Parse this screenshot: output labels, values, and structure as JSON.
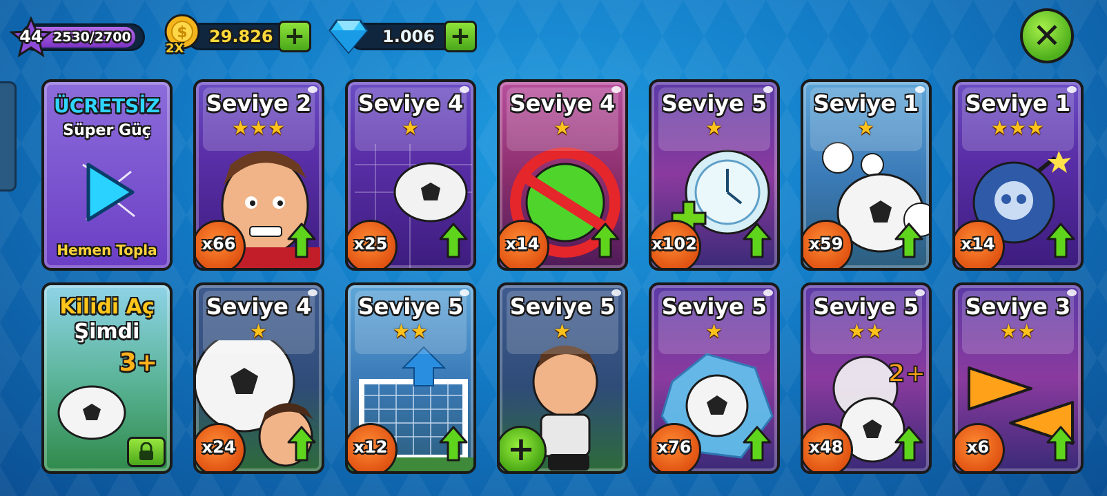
{
  "header": {
    "level": "44",
    "xp": "2530/2700",
    "xp_progress": 0.937,
    "coins": "29.826",
    "coin_multiplier": "2X",
    "gems": "1.006",
    "coin_plus_icon": "plus-icon",
    "gem_plus_icon": "plus-icon",
    "close_icon": "close-icon"
  },
  "special_cards": {
    "free": {
      "title": "ÜCRETSİZ",
      "subtitle": "Süper Güç",
      "footer": "Hemen Topla",
      "icon": "play-icon"
    },
    "unlock": {
      "title": "Kilidi Aç",
      "subtitle": "Şimdi",
      "badge": "3+",
      "icon": "lock-icon"
    }
  },
  "cards": [
    {
      "title": "Seviye 2",
      "stars": 3,
      "count": "x66",
      "art": "player-head",
      "theme": "purple"
    },
    {
      "title": "Seviye 4",
      "stars": 1,
      "count": "x25",
      "art": "fire-ball-net",
      "theme": "purple"
    },
    {
      "title": "Seviye 4",
      "stars": 1,
      "count": "x14",
      "art": "no-fire-ball",
      "theme": "pink"
    },
    {
      "title": "Seviye 5",
      "stars": 1,
      "count": "x102",
      "art": "time-plus",
      "theme": "space"
    },
    {
      "title": "Seviye 1",
      "stars": 1,
      "count": "x59",
      "art": "multi-ball",
      "theme": "blue-sky"
    },
    {
      "title": "Seviye 1",
      "stars": 3,
      "count": "x14",
      "art": "skull-bomb",
      "theme": "purple"
    },
    {
      "title": "Seviye 4",
      "stars": 1,
      "count": "x24",
      "art": "big-ball",
      "theme": "stadium"
    },
    {
      "title": "Seviye 5",
      "stars": 2,
      "count": "x12",
      "art": "goal-up",
      "theme": "blue-sky"
    },
    {
      "title": "Seviye 5",
      "stars": 1,
      "count": "",
      "art": "player-body",
      "theme": "stadium"
    },
    {
      "title": "Seviye 5",
      "stars": 1,
      "count": "x76",
      "art": "ice-ball",
      "theme": "space"
    },
    {
      "title": "Seviye 5",
      "stars": 2,
      "count": "x48",
      "art": "double-ball",
      "theme": "space"
    },
    {
      "title": "Seviye 3",
      "stars": 2,
      "count": "x6",
      "art": "fast-arrows",
      "theme": "space"
    }
  ],
  "colors": {
    "accent_green": "#4fb01c",
    "coin_yellow": "#ffd93a",
    "badge_orange": "#e05312",
    "star_gold": "#ffc21a"
  }
}
